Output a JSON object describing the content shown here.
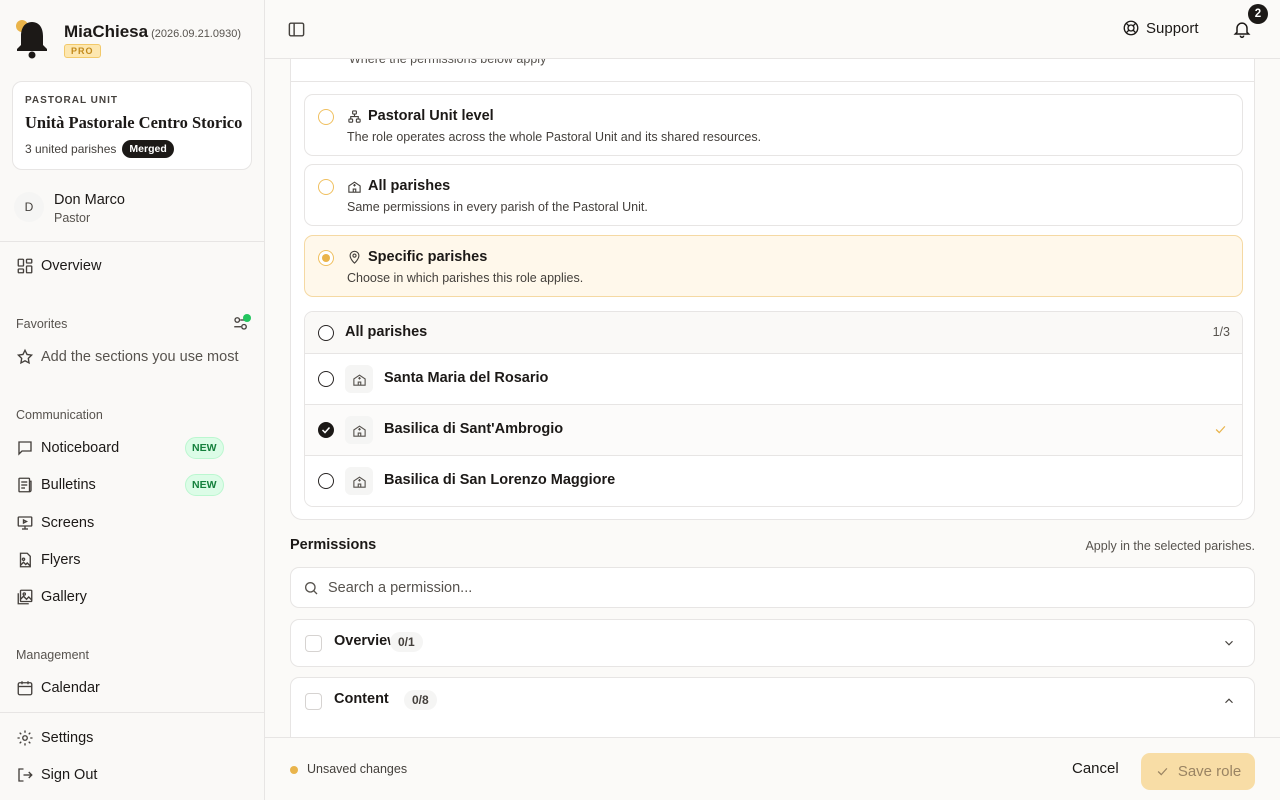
{
  "app": {
    "name": "MiaChiesa",
    "version": "(2026.09.21.0930)",
    "plan_badge": "PRO"
  },
  "unit": {
    "eyebrow": "PASTORAL UNIT",
    "name": "Unità Pastorale Centro Storico",
    "subtitle": "3 united parishes",
    "badge": "Merged"
  },
  "user": {
    "initial": "D",
    "name": "Don Marco",
    "role": "Pastor"
  },
  "sidebar": {
    "overview": "Overview",
    "favorites_label": "Favorites",
    "favorites_hint": "Add the sections you use most",
    "communication_label": "Communication",
    "communication_items": [
      {
        "label": "Noticeboard",
        "badge": "NEW"
      },
      {
        "label": "Bulletins",
        "badge": "NEW"
      },
      {
        "label": "Screens"
      },
      {
        "label": "Flyers"
      },
      {
        "label": "Gallery"
      }
    ],
    "management_label": "Management",
    "calendar": "Calendar",
    "settings": "Settings",
    "sign_out": "Sign Out"
  },
  "topbar": {
    "support": "Support",
    "notifications_count": "2"
  },
  "scope": {
    "header_sub": "Where the permissions below apply",
    "options": [
      {
        "title": "Pastoral Unit level",
        "desc": "The role operates across the whole Pastoral Unit and its shared resources.",
        "selected": false
      },
      {
        "title": "All parishes",
        "desc": "Same permissions in every parish of the Pastoral Unit.",
        "selected": false
      },
      {
        "title": "Specific parishes",
        "desc": "Choose in which parishes this role applies.",
        "selected": true
      }
    ],
    "parish_header": "All parishes",
    "parish_count": "1/3",
    "parishes": [
      {
        "name": "Santa Maria del Rosario",
        "checked": false
      },
      {
        "name": "Basilica di Sant'Ambrogio",
        "checked": true
      },
      {
        "name": "Basilica di San Lorenzo Maggiore",
        "checked": false
      }
    ]
  },
  "permissions": {
    "title": "Permissions",
    "hint": "Apply in the selected parishes.",
    "search_placeholder": "Search a permission...",
    "groups": [
      {
        "title": "Overview",
        "count": "0/1",
        "expanded": false
      },
      {
        "title": "Content",
        "count": "0/8",
        "expanded": true
      }
    ]
  },
  "footer": {
    "status": "Unsaved changes",
    "cancel": "Cancel",
    "save": "Save role"
  },
  "colors": {
    "accent": "#e9b44c",
    "accent_soft": "#fff8eb",
    "dark": "#1c1917",
    "new_badge": "#15803d",
    "online": "#22c55e"
  }
}
